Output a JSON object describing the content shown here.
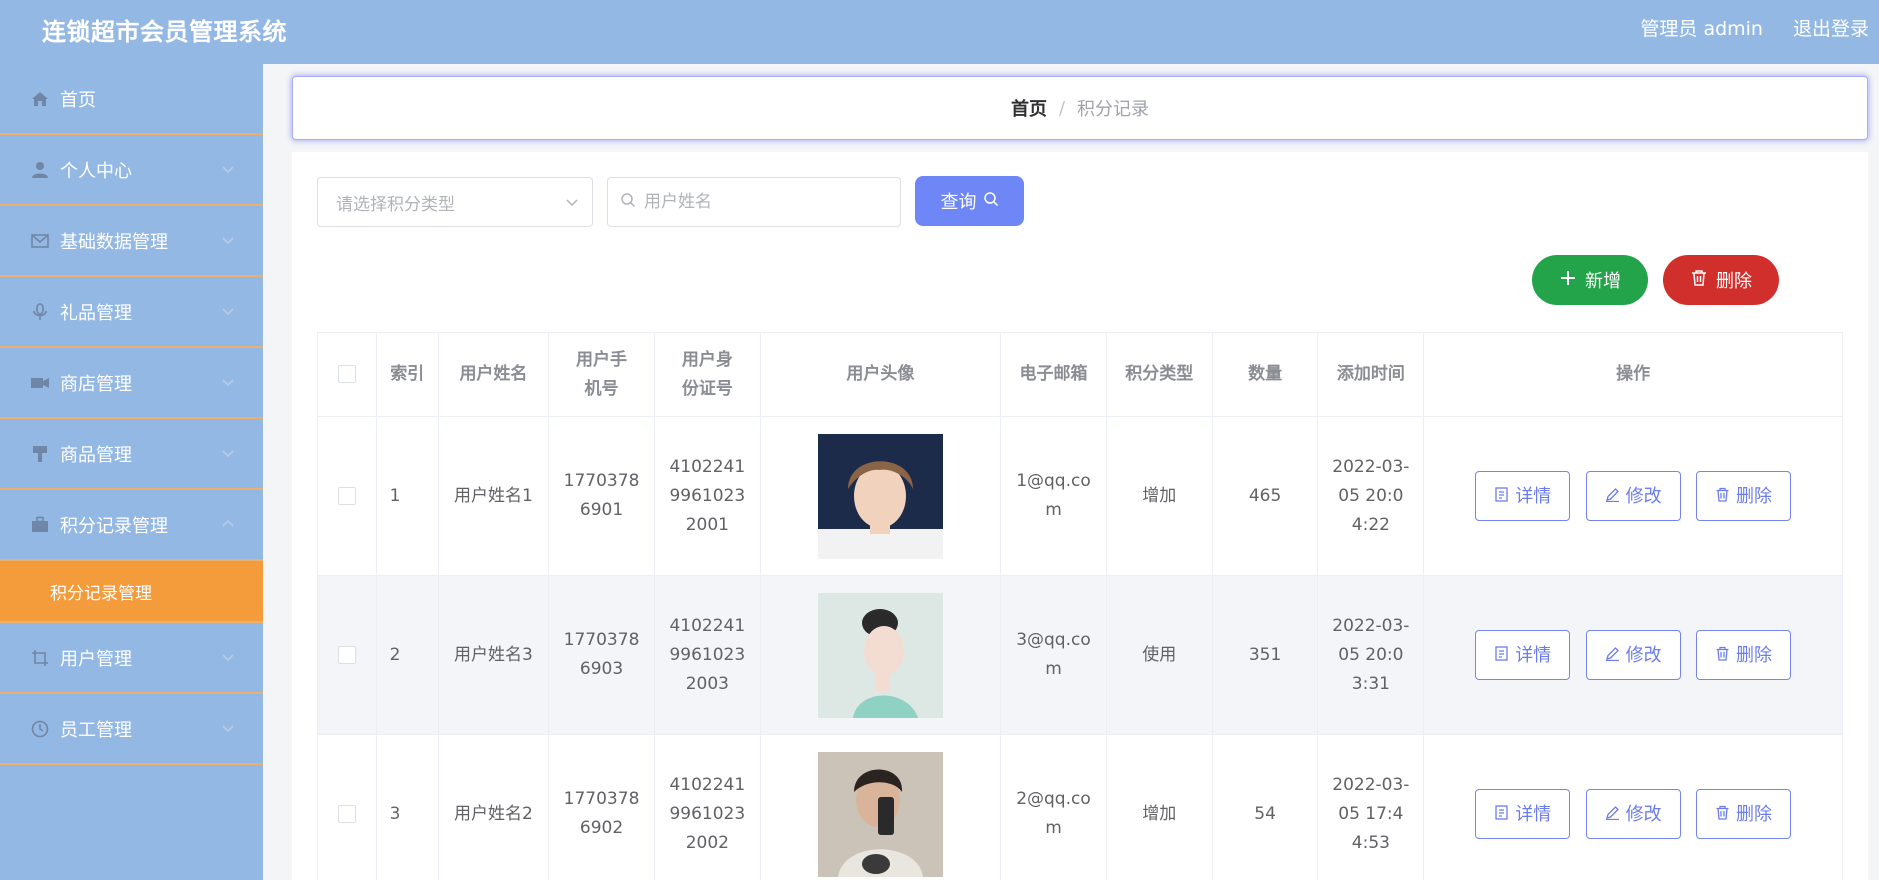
{
  "app": {
    "title": "连锁超市会员管理系统"
  },
  "topbar": {
    "user_label": "管理员 admin",
    "logout_label": "退出登录"
  },
  "sidebar": {
    "items": [
      {
        "label": "首页",
        "icon": "home-icon",
        "has_arrow": false
      },
      {
        "label": "个人中心",
        "icon": "user-icon",
        "has_arrow": true
      },
      {
        "label": "基础数据管理",
        "icon": "mail-icon",
        "has_arrow": true
      },
      {
        "label": "礼品管理",
        "icon": "microphone-icon",
        "has_arrow": true
      },
      {
        "label": "商店管理",
        "icon": "camera-icon",
        "has_arrow": true
      },
      {
        "label": "商品管理",
        "icon": "brush-icon",
        "has_arrow": true
      },
      {
        "label": "积分记录管理",
        "icon": "briefcase-icon",
        "has_arrow": true,
        "expanded": true
      },
      {
        "label": "用户管理",
        "icon": "crop-icon",
        "has_arrow": true
      },
      {
        "label": "员工管理",
        "icon": "clock-icon",
        "has_arrow": true
      }
    ],
    "active_sub_item": "积分记录管理"
  },
  "breadcrumb": {
    "home": "首页",
    "separator": "/",
    "current": "积分记录"
  },
  "filters": {
    "type_placeholder": "请选择积分类型",
    "name_placeholder": "用户姓名",
    "query_label": "查询"
  },
  "actions": {
    "add_label": "新增",
    "delete_label": "删除"
  },
  "table": {
    "headers": {
      "index": "索引",
      "name": "用户姓名",
      "phone": "用户手机号",
      "idcard": "用户身份证号",
      "avatar": "用户头像",
      "email": "电子邮箱",
      "type": "积分类型",
      "amount": "数量",
      "time": "添加时间",
      "ops": "操作"
    },
    "rows": [
      {
        "index": "1",
        "name": "用户姓名1",
        "phone": "17703786901",
        "idcard": "410224199610232001",
        "email": "1@qq.com",
        "type": "增加",
        "amount": "465",
        "time": "2022-03-05 20:04:22"
      },
      {
        "index": "2",
        "name": "用户姓名3",
        "phone": "17703786903",
        "idcard": "410224199610232003",
        "email": "3@qq.com",
        "type": "使用",
        "amount": "351",
        "time": "2022-03-05 20:03:31"
      },
      {
        "index": "3",
        "name": "用户姓名2",
        "phone": "17703786902",
        "idcard": "410224199610232002",
        "email": "2@qq.com",
        "type": "增加",
        "amount": "54",
        "time": "2022-03-05 17:44:53"
      }
    ],
    "op_labels": {
      "detail": "详情",
      "edit": "修改",
      "delete": "删除"
    }
  },
  "colors": {
    "topbar": "#94b8e4",
    "menu_border": "#e9b06e",
    "active_sub": "#f49b3b",
    "query_button": "#6e86f6",
    "add_button": "#23a34a",
    "delete_button": "#d12f2b",
    "op_button_border": "#7485ef"
  }
}
